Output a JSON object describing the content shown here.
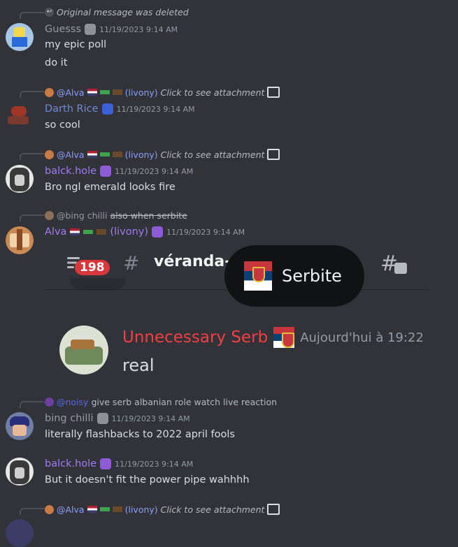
{
  "messages": [
    {
      "reply": {
        "text": "Original message was deleted"
      },
      "author": "Guesss",
      "timestamp": "11/19/2023 9:14 AM",
      "lines": [
        "my epic poll",
        "do it"
      ]
    },
    {
      "reply": {
        "mention": "@Alva",
        "mention_suffix": "(livony)",
        "text": "Click to see attachment"
      },
      "author": "Darth Rice",
      "timestamp": "11/19/2023 9:14 AM",
      "lines": [
        "so cool"
      ]
    },
    {
      "reply": {
        "mention": "@Alva",
        "mention_suffix": "(livony)",
        "text": "Click to see attachment"
      },
      "author": "balck.hole",
      "timestamp": "11/19/2023 9:14 AM",
      "lines": [
        "Bro ngl emerald looks fire"
      ]
    },
    {
      "reply": {
        "mention": "@bing chilli",
        "text": "also when serbite"
      },
      "author": "Alva",
      "author_suffix": "(livony)",
      "timestamp": "11/19/2023 9:14 AM"
    },
    {
      "reply": {
        "mention": "@noisy",
        "text": "give serb albanian role watch live reaction"
      },
      "author": "bing chilli",
      "timestamp": "11/19/2023 9:14 AM",
      "lines": [
        "literally flashbacks to 2022 april fools"
      ]
    },
    {
      "author": "balck.hole",
      "timestamp": "11/19/2023 9:14 AM",
      "lines": [
        "But it doesn't fit the power pipe wahhhh"
      ]
    },
    {
      "reply": {
        "mention": "@Alva",
        "mention_suffix": "(livony)",
        "text": "Click to see attachment"
      }
    }
  ],
  "embed": {
    "channel_name": "véranda-",
    "badge_count": "198",
    "tooltip_label": "Serbite",
    "author": "Unnecessary Serb",
    "timestamp": "Aujourd'hui à 19:22",
    "text": "real"
  },
  "colors": {
    "background": "#313338",
    "username_blue": "#7289da",
    "username_purple": "#a07cf5",
    "username_grey": "#949ba4",
    "embed_author_red": "#f23f43",
    "mention": "#8c9eff"
  }
}
